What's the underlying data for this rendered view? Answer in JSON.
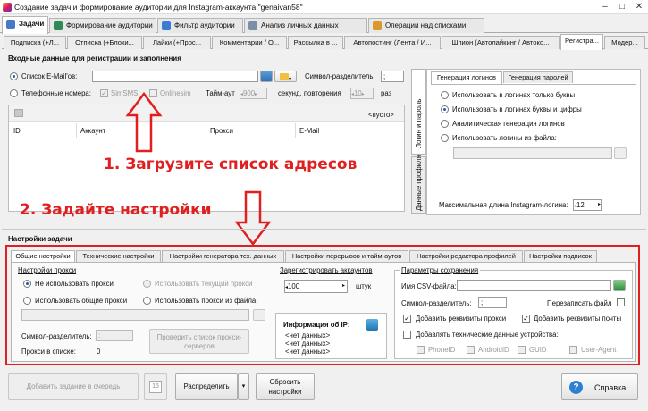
{
  "window": {
    "title": "Создание задач и формирование аудитории для Instagram-аккаунта \"genaivan58\"",
    "min": "–",
    "max": "□",
    "close": "✕"
  },
  "main_tabs": [
    {
      "label": "Задачи",
      "color": "#4a78c9"
    },
    {
      "label": "Формирование аудитории",
      "color": "#2e8b57"
    },
    {
      "label": "Фильтр аудитории",
      "color": "#3a7bd5"
    },
    {
      "label": "Анализ личных данных",
      "color": "#7b8fa6"
    },
    {
      "label": "Операции над списками",
      "color": "#d99a2b"
    }
  ],
  "sub_tabs": [
    "Подписка (+Л...",
    "Отписка (+Блоки...",
    "Лайки (+Прос...",
    "Комментарии / О...",
    "Рассылка в ...",
    "Автопостинг (Лента / И...",
    "Шпион (Автолайкинг / Автоко...",
    "Регистра...",
    "Модер..."
  ],
  "input_section": {
    "title": "Входные данные для регистрации и заполнения",
    "email_list_label": "Список E-Mail'ов:",
    "separator_label": "Символ-разделитель:",
    "separator_value": ";",
    "phones_label": "Телефонные номера:",
    "simsms": "SimSMS",
    "onlinesim": "Onlinesim",
    "timeout_label": "Тайм-аут",
    "timeout_value": "900",
    "seconds_repeat": "секунд, повторения",
    "repeat_value": "10",
    "times": "раз",
    "empty_label": "<пусто>",
    "columns": [
      "ID",
      "Аккаунт",
      "Прокси",
      "E-Mail"
    ]
  },
  "side_tabs": {
    "logins": "Логин и пароль",
    "profile": "Данные профиля"
  },
  "login_gen": {
    "tabs": [
      "Генерация логинов",
      "Генерация паролей"
    ],
    "options": [
      "Использовать в логинах только буквы",
      "Использовать в логинах буквы и цифры",
      "Аналитическая генерация логинов",
      "Использовать логины из файла:"
    ],
    "max_len_label": "Максимальная длина Instagram-логина:",
    "max_len_value": "12"
  },
  "annotations": {
    "step1": "1. Загрузите список адресов",
    "step2": "2. Задайте настройки"
  },
  "task_settings": {
    "title": "Настройки задачи",
    "tabs": [
      "Общие настройки",
      "Технические настройки",
      "Настройки генератора тех. данных",
      "Настройки перерывов и тайм-аутов",
      "Настройки редактора профилей",
      "Настройки подписок"
    ],
    "proxy_group": "Настройки прокси",
    "proxy_opts": [
      "Не использовать прокси",
      "Использовать текущий прокси",
      "Использовать общие прокси",
      "Использовать прокси из файла"
    ],
    "proxy_sep_label": "Символ-разделитель:",
    "proxy_sep_value": ":",
    "proxy_count_label": "Прокси в списке:",
    "proxy_count_value": "0",
    "check_proxy_btn": "Проверить список прокси-серверов",
    "register_group": "Зарегистрировать аккаунтов",
    "register_value": "100",
    "register_unit": "штук",
    "ip_title": "Информация об IP:",
    "ip_lines": [
      "<нет данных>",
      "<нет данных>",
      "<нет данных>"
    ],
    "save_group": "Параметры сохранения",
    "csv_label": "Имя CSV-файла:",
    "save_sep_label": "Символ-разделитель:",
    "save_sep_value": ";",
    "overwrite_label": "Перезаписать файл",
    "add_proxy": "Добавить реквизиты прокси",
    "add_mail": "Добавить реквизиты почты",
    "add_tech": "Добавлять технические данные устройства:",
    "tech_items": [
      "PhoneID",
      "AndroidID",
      "GUID",
      "User-Agent"
    ]
  },
  "bottom": {
    "add_task": "Добавить задание в очередь",
    "calendar_day": "15",
    "distribute": "Распределить",
    "reset": "Сбросить настройки",
    "help": "Справка"
  }
}
